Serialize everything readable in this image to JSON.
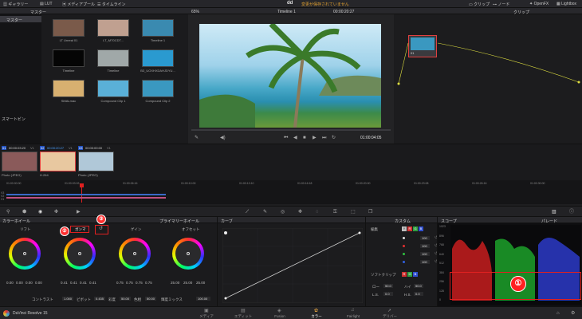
{
  "topbar": {
    "gallery": "ギャラリー",
    "lut": "LUT",
    "media_pool": "メディアプール",
    "timeline": "タイムライン",
    "project_name": "dd",
    "unsaved": "変更が保存されていません",
    "clips": "クリップ",
    "nodes": "ノード",
    "openfx": "OpenFX",
    "lightbox": "Lightbox"
  },
  "media": {
    "master_header": "マスター",
    "bin_master": "マスター",
    "smart_bins": "スマートビン",
    "thumbs": [
      {
        "label": "LT Unreal 01",
        "color": "#7a5a4a"
      },
      {
        "label": "LT_MT0CDT...",
        "color": "#c0a090"
      },
      {
        "label": "Timeline 1",
        "color": "#3a8ab0"
      },
      {
        "label": "Timeline",
        "color": "#050505"
      },
      {
        "label": "Timeline",
        "color": "#a0a8a8"
      },
      {
        "label": "B3_UOXHXDAHJDYU...",
        "color": "#2a9ad0"
      },
      {
        "label": "SMALmac",
        "color": "#d8b070"
      },
      {
        "label": "Compound Clip 1",
        "color": "#5ab0d8"
      },
      {
        "label": "Compound Clip 2",
        "color": "#3a98c0"
      }
    ]
  },
  "viewer": {
    "zoom": "65%",
    "timeline_name": "Timeline 1",
    "timecode_top": "00:00:20:27",
    "timecode_bottom": "01:00:04:05",
    "clip_label": "クリップ"
  },
  "nodes": {
    "node_label": "01"
  },
  "clips_strip": [
    {
      "index": "01",
      "tc": "00:00:03:20",
      "track": "V1",
      "label": "Photo (JPEG)"
    },
    {
      "index": "02",
      "tc": "00:00:20:27",
      "track": "V1",
      "label": "H.264"
    },
    {
      "index": "03",
      "tc": "00:00:00:00",
      "track": "V1",
      "label": "Photo (JPEG)"
    }
  ],
  "ruler": [
    "01:00:00:00",
    "01:00:03:03",
    "01:00:06:16",
    "01:00:10:00",
    "01:00:13:10",
    "01:00:16:18",
    "01:00:20:00",
    "01:00:23:08",
    "01:00:26:16",
    "01:00:30:00"
  ],
  "color_wheels": {
    "header": "カラーホイール",
    "mode": "プライマリーホイール",
    "lift": "リフト",
    "gamma": "ガンマ",
    "gain": "ゲイン",
    "offset": "オフセット",
    "lift_vals": [
      "0.00",
      "0.00",
      "0.00",
      "0.00"
    ],
    "gamma_vals": [
      "0.41",
      "0.41",
      "0.41",
      "0.41"
    ],
    "gain_vals": [
      "0.75",
      "0.75",
      "0.75",
      "0.75"
    ],
    "offset_vals": [
      "25.00",
      "25.00",
      "25.00"
    ],
    "contrast_label": "コントラスト",
    "contrast_val": "1.000",
    "pivot_label": "ピボット",
    "pivot_val": "0.435",
    "sat_label": "彩度",
    "sat_val": "50.00",
    "hue_label": "色相",
    "hue_val": "50.00",
    "lum_mix_label": "輝度ミックス",
    "lum_mix_val": "100.00"
  },
  "curves": {
    "header": "カーブ",
    "custom": "カスタム",
    "edit": "編集",
    "soft_clip": "ソフトクリップ",
    "low": "ロー",
    "high": "ハイ",
    "ls": "L.S.",
    "hs": "H.S.",
    "low_val": "50.0",
    "high_val": "50.0",
    "ls_val": "0.0",
    "hs_val": "0.0",
    "intensities": [
      "100",
      "100",
      "100",
      "100"
    ]
  },
  "scope": {
    "header": "スコープ",
    "mode": "パレード",
    "ticks": [
      "1023",
      "896",
      "768",
      "640",
      "512",
      "384",
      "256",
      "128",
      "0"
    ]
  },
  "annotations": {
    "one": "①",
    "two": "②",
    "three": "③"
  },
  "bottom": {
    "app_name": "DaVinci Resolve 15",
    "tabs": [
      "メディア",
      "エディット",
      "Fusion",
      "カラー",
      "Fairlight",
      "デリバー"
    ]
  }
}
